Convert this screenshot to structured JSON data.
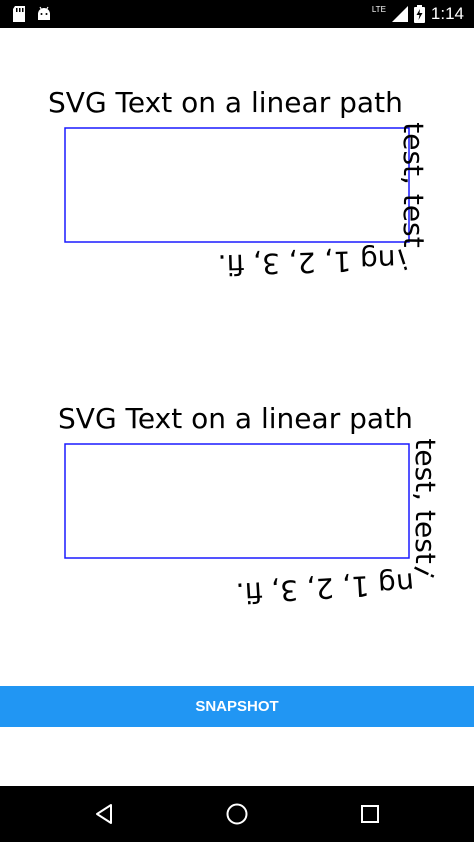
{
  "status_bar": {
    "time": "1:14",
    "network": "LTE",
    "icons": [
      "sd-card-icon",
      "android-icon",
      "signal-icon",
      "battery-charging-icon"
    ]
  },
  "demos": [
    {
      "path_text": "SVG Text on a linear path test, testing 1, 2, 3, fi.",
      "rect_stroke": "#1a1aff"
    },
    {
      "path_text": "SVG Text on a linear path test, testing 1, 2, 3, fi.",
      "rect_stroke": "#1a1aff"
    }
  ],
  "snapshot_button": {
    "label": "SNAPSHOT",
    "color": "#2196F3"
  },
  "nav_bar": {
    "icons": [
      "back-icon",
      "home-icon",
      "recents-icon"
    ]
  }
}
